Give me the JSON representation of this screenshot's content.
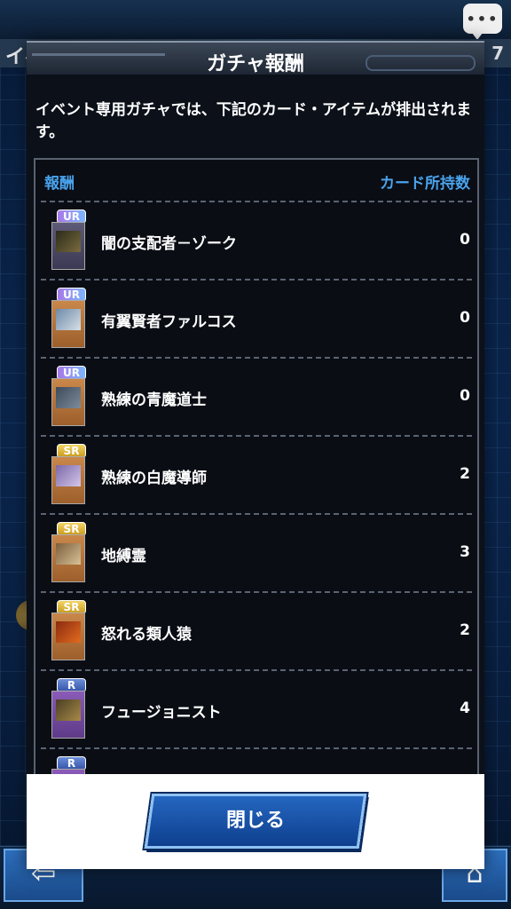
{
  "background": {
    "title": "イベ",
    "number": "7"
  },
  "modal": {
    "title": "ガチャ報酬",
    "description": "イベント専用ガチャでは、下記のカード・アイテムが排出されます。",
    "list_header": {
      "reward_label": "報酬",
      "owned_label": "カード所持数"
    },
    "rewards": [
      {
        "rarity": "UR",
        "name": "闇の支配者－ゾーク",
        "count": "0"
      },
      {
        "rarity": "UR",
        "name": "有翼賢者ファルコス",
        "count": "0"
      },
      {
        "rarity": "UR",
        "name": "熟練の青魔道士",
        "count": "0"
      },
      {
        "rarity": "SR",
        "name": "熟練の白魔導師",
        "count": "2"
      },
      {
        "rarity": "SR",
        "name": "地縛霊",
        "count": "3"
      },
      {
        "rarity": "SR",
        "name": "怒れる類人猿",
        "count": "2"
      },
      {
        "rarity": "R",
        "name": "フュージョニスト",
        "count": "4"
      },
      {
        "rarity": "R",
        "name": "",
        "count": ""
      }
    ],
    "close_label": "閉じる"
  },
  "icons": {
    "chat": "chat-bubble-icon",
    "back": "back-arrow-icon",
    "home": "home-icon"
  },
  "colors": {
    "accent_blue": "#4aa3ec",
    "button_blue": "#1a55a8",
    "ur_badge": "#9a86f0",
    "sr_badge": "#e0b838",
    "r_badge": "#4b6fc2"
  }
}
